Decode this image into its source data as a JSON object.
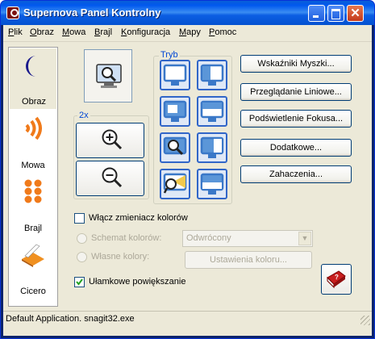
{
  "window": {
    "title": "Supernova Panel Kontrolny"
  },
  "menu": [
    "Plik",
    "Obraz",
    "Mowa",
    "Brajl",
    "Konfiguracja",
    "Mapy",
    "Pomoc"
  ],
  "sidebar": {
    "items": [
      {
        "label": "Obraz",
        "icon": "moon-icon",
        "selected": true
      },
      {
        "label": "Mowa",
        "icon": "sound-waves-icon",
        "selected": false
      },
      {
        "label": "Brajl",
        "icon": "braille-dots-icon",
        "selected": false
      },
      {
        "label": "Cicero",
        "icon": "scanner-icon",
        "selected": false
      }
    ]
  },
  "magnifier": {
    "zoom_level": "2x",
    "zoom_in_icon": "zoom-in-icon",
    "zoom_out_icon": "zoom-out-icon",
    "main_icon": "monitor-magnifier-icon"
  },
  "mode_group": {
    "title": "Tryb"
  },
  "buttons": [
    "Wskaźniki Myszki...",
    "Przeglądanie Liniowe...",
    "Podświetlenie Fokusa...",
    "Dodatkowe...",
    "Zahaczenia..."
  ],
  "color_changer": {
    "enable_label": "Włącz zmieniacz kolorów",
    "enabled": false,
    "scheme_label": "Schemat kolorów:",
    "scheme_value": "Odwrócony",
    "custom_label": "Własne kolory:",
    "color_settings_button": "Ustawienia koloru..."
  },
  "fractional": {
    "label": "Ułamkowe powiększanie",
    "checked": true
  },
  "status": {
    "text": "Default Application. snagit32.exe"
  },
  "colors": {
    "titlebar": "#0058ee",
    "face": "#ece9d8",
    "accent": "#3166c8",
    "close": "#c4391b"
  }
}
